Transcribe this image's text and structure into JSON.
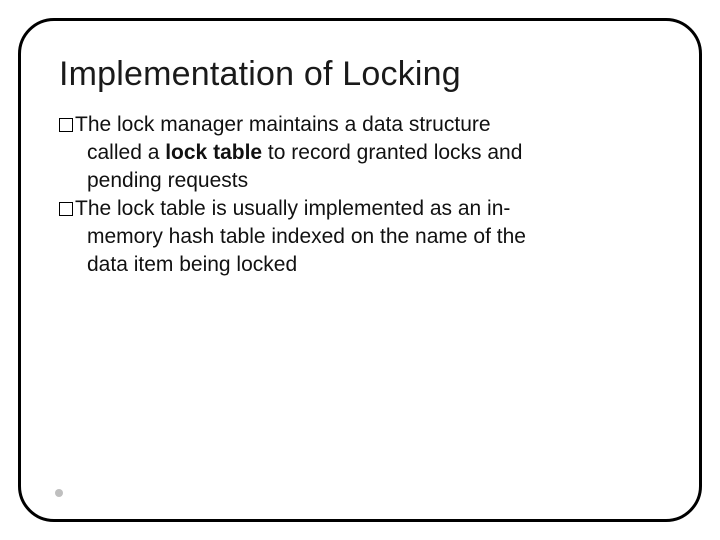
{
  "title": "Implementation of Locking",
  "bullets": [
    {
      "line1_pre": "The lock manager maintains a data structure",
      "line2_pre": "called a ",
      "term": "lock table",
      "line2_post": " to record granted locks and",
      "line3": "pending requests"
    },
    {
      "line1_pre": "The lock table is usually implemented as an in-",
      "line2": "memory hash table indexed on the name of the",
      "line3": "data item being locked"
    }
  ]
}
